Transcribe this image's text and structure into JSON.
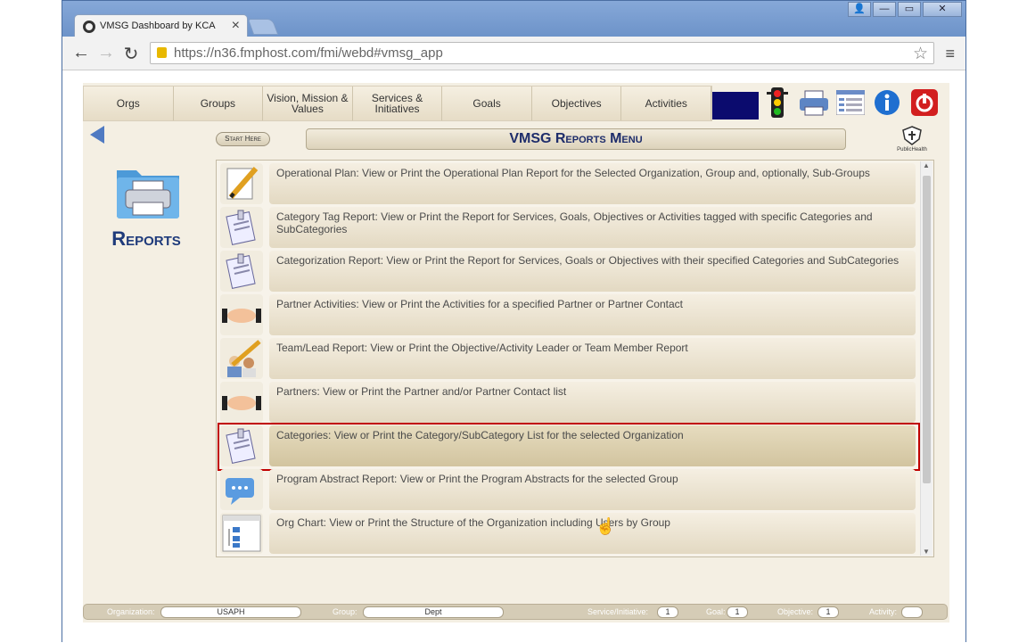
{
  "browser": {
    "tab_title": "VMSG Dashboard by KCA",
    "tab_close": "×",
    "url": "https://n36.fmphost.com/fmi/webd#vmsg_app",
    "window_buttons": [
      "👤",
      "—",
      "▭",
      "✕"
    ],
    "nav_back": "←",
    "nav_forward": "→",
    "reload": "↻",
    "star": "☆",
    "menu": "≡"
  },
  "nav": {
    "tabs": [
      {
        "label": "Orgs"
      },
      {
        "label": "Groups"
      },
      {
        "label": "Vision, Mission & Values"
      },
      {
        "label": "Services & Initiatives"
      },
      {
        "label": "Goals"
      },
      {
        "label": "Objectives"
      },
      {
        "label": "Activities"
      }
    ],
    "tool_icons": [
      "traffic-light-icon",
      "printer-icon",
      "list-icon",
      "info-icon",
      "power-icon"
    ]
  },
  "header": {
    "start_here": "Start Here",
    "title": "VMSG Reports Menu",
    "logo_text": "PublicHealth"
  },
  "sidebar": {
    "label": "Reports"
  },
  "reports": [
    {
      "icon": "pencil-notepad-icon",
      "text": "Operational Plan: View or Print the Operational Plan Report for the Selected Organization, Group and, optionally, Sub-Groups"
    },
    {
      "icon": "clipboard-icon",
      "text": "Category Tag Report: View or Print the Report for Services, Goals, Objectives or Activities tagged with specific Categories and SubCategories"
    },
    {
      "icon": "clipboard-icon",
      "text": "Categorization Report: View or Print the Report for Services, Goals or Objectives with their specified Categories and SubCategories"
    },
    {
      "icon": "handshake-icon",
      "text": "Partner Activities: View or Print the Activities for a specified Partner or Partner Contact"
    },
    {
      "icon": "team-pencil-icon",
      "text": "Team/Lead Report: View or Print the Objective/Activity Leader or Team Member Report"
    },
    {
      "icon": "handshake-icon",
      "text": "Partners: View or Print the Partner and/or Partner Contact list"
    },
    {
      "icon": "clipboard-icon",
      "text": "Categories: View or Print the Category/SubCategory List for the selected Organization",
      "selected": true
    },
    {
      "icon": "speech-bubble-icon",
      "text": "Program Abstract Report: View or Print the Program Abstracts for the selected Group"
    },
    {
      "icon": "org-chart-icon",
      "text": "Org Chart: View or Print the Structure of the Organization including Users by Group"
    }
  ],
  "status_bar": {
    "organization_label": "Organization:",
    "organization_value": "USAPH",
    "group_label": "Group:",
    "group_value": "Dept",
    "service_label": "Service/Initiative:",
    "service_value": "1",
    "goal_label": "Goal:",
    "goal_value": "1",
    "objective_label": "Objective:",
    "objective_value": "1",
    "activity_label": "Activity:",
    "activity_value": ""
  },
  "colors": {
    "accent_blue": "#1f3b7b",
    "selection_red": "#c00000",
    "nav_block": "#0b0b6e"
  }
}
